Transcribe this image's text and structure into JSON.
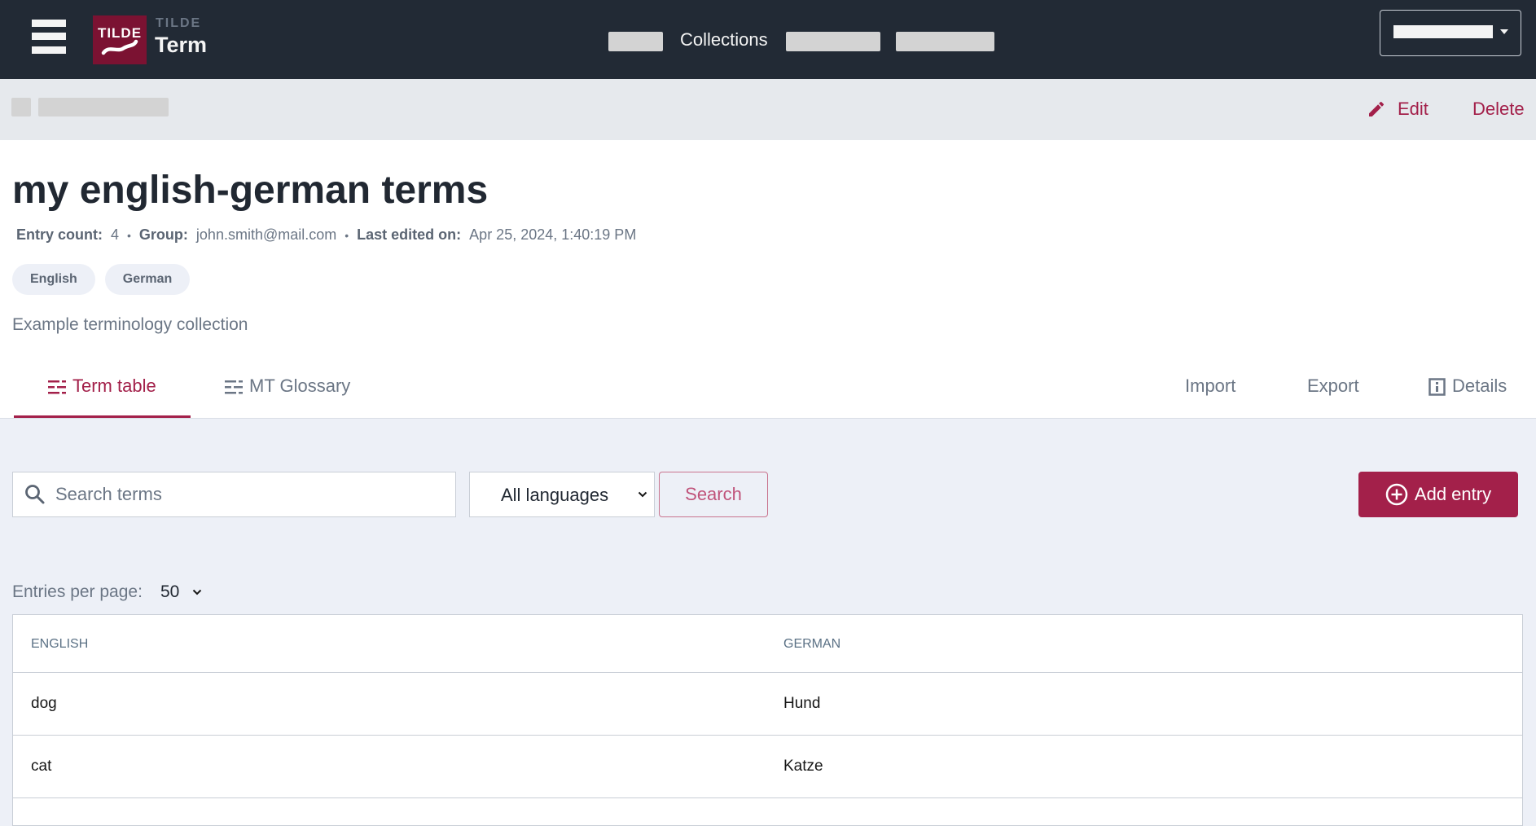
{
  "header": {
    "brand_small": "TILDE",
    "brand_name": "Term",
    "nav": {
      "collections": "Collections"
    }
  },
  "subbar": {
    "edit_label": "Edit",
    "delete_label": "Delete"
  },
  "collection": {
    "title": "my english-german terms",
    "meta": {
      "entry_count_label": "Entry count:",
      "entry_count": "4",
      "group_label": "Group:",
      "group": "john.smith@mail.com",
      "last_edited_label": "Last edited on:",
      "last_edited": "Apr 25, 2024, 1:40:19 PM"
    },
    "languages": [
      "English",
      "German"
    ],
    "description": "Example terminology collection"
  },
  "tabs": [
    {
      "label": "Term table",
      "active": true
    },
    {
      "label": "MT Glossary",
      "active": false
    }
  ],
  "actions": {
    "import": "Import",
    "export": "Export",
    "details": "Details"
  },
  "toolbar": {
    "search_placeholder": "Search terms",
    "search_value": "",
    "language_selected": "All languages",
    "search_button": "Search",
    "add_entry_button": "Add entry"
  },
  "pagination": {
    "entries_per_page_label": "Entries per page:",
    "entries_per_page": "50"
  },
  "table": {
    "columns": [
      "ENGLISH",
      "GERMAN"
    ],
    "rows": [
      [
        "dog",
        "Hund"
      ],
      [
        "cat",
        "Katze"
      ]
    ]
  },
  "colors": {
    "accent": "#a3204a",
    "topbar": "#222a35",
    "logo_bg": "#7b1232"
  }
}
